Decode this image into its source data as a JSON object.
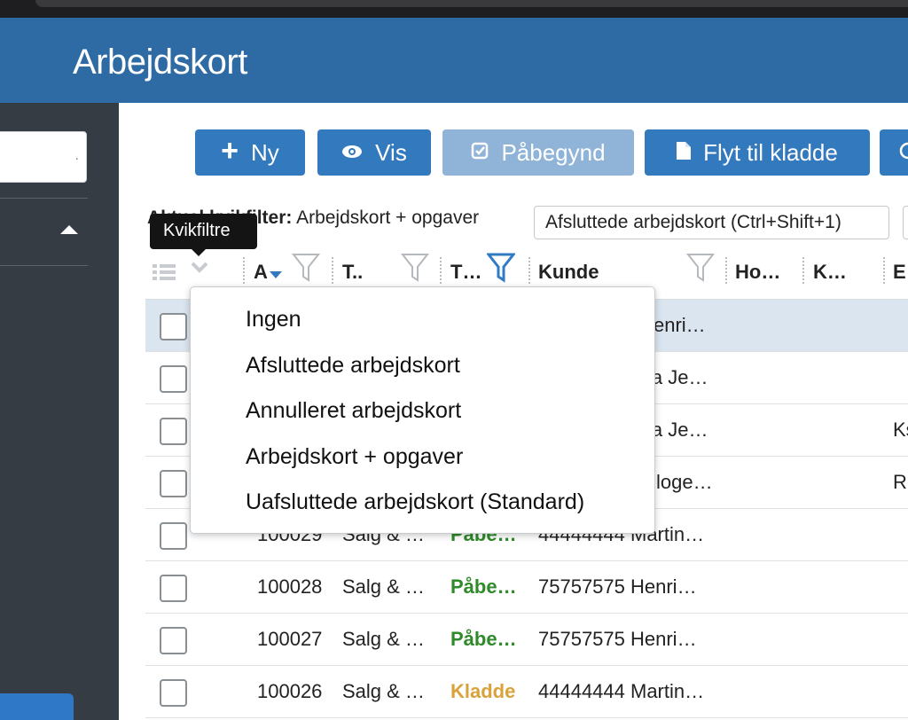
{
  "header": {
    "title": "Arbejdskort"
  },
  "sidebar": {
    "search_placeholder": "."
  },
  "toolbar": {
    "new_label": "Ny",
    "view_label": "Vis",
    "started_label": "Påbegynd",
    "move_label": "Flyt til kladde"
  },
  "quickfilter": {
    "label": "Aktuel kvikfilter:",
    "current": "Arbejdskort + opgaver",
    "pill": "Afsluttede arbejdskort (Ctrl+Shift+1)",
    "tooltip": "Kvikfiltre"
  },
  "columns": [
    "A",
    "T..",
    "T…",
    "Kunde",
    "Ho…",
    "K…",
    "E"
  ],
  "dropdown": {
    "items": [
      "Ingen",
      "Afsluttede arbejdskort",
      "Annulleret arbejdskort",
      "Arbejdskort + opgaver",
      "Uafsluttede arbejdskort (Standard)"
    ]
  },
  "rows": [
    {
      "customer": "enri…",
      "extra": ""
    },
    {
      "customer": "ia Je…",
      "extra": ""
    },
    {
      "customer": "ia Je…",
      "extra": "Ks"
    },
    {
      "customer": "loge…",
      "extra": "R"
    },
    {
      "id": "100029",
      "type": "Salg & …",
      "status": "Påbe…",
      "customer": "44444444 Martin…"
    },
    {
      "id": "100028",
      "type": "Salg & …",
      "status": "Påbe…",
      "customer": "75757575 Henri…"
    },
    {
      "id": "100027",
      "type": "Salg & …",
      "status": "Påbe…",
      "customer": "75757575 Henri…"
    },
    {
      "id": "100026",
      "type": "Salg & …",
      "status": "Kladde",
      "customer": "44444444 Martin…"
    }
  ],
  "colors": {
    "header_bg": "#2e6aa4",
    "button_bg": "#3379bd",
    "status_started": "#2f8a2a",
    "status_draft": "#d9a23a"
  }
}
